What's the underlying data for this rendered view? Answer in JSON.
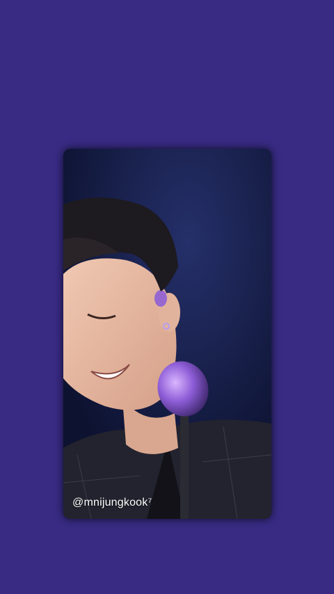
{
  "theme": {
    "background_color": "#392b84",
    "card_shadow": "#0b0e24"
  },
  "photo": {
    "watermark_text": "@mnijungkook⁷"
  }
}
